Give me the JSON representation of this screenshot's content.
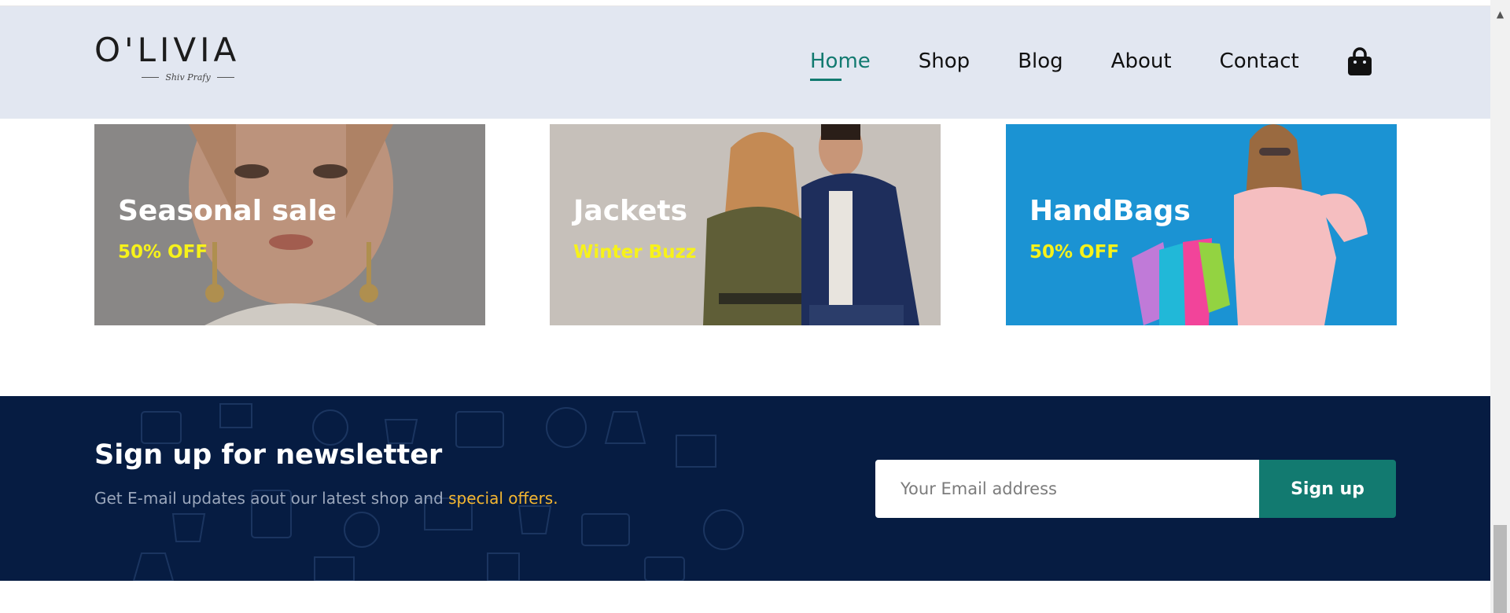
{
  "header": {
    "logo_text": "O'LIVIA",
    "logo_tagline": "Shiv Prafy",
    "nav": [
      {
        "label": "Home",
        "active": true
      },
      {
        "label": "Shop",
        "active": false
      },
      {
        "label": "Blog",
        "active": false
      },
      {
        "label": "About",
        "active": false
      },
      {
        "label": "Contact",
        "active": false
      }
    ],
    "cart_icon": "shopping-bag-icon"
  },
  "promos": [
    {
      "title": "Seasonal sale",
      "subtitle": "50% OFF"
    },
    {
      "title": "Jackets",
      "subtitle": "Winter Buzz"
    },
    {
      "title": "HandBags",
      "subtitle": "50% OFF"
    }
  ],
  "newsletter": {
    "title": "Sign up for newsletter",
    "desc_prefix": "Get E-mail updates aout our latest shop and ",
    "desc_highlight": "special offers.",
    "email_placeholder": "Your Email address",
    "button_label": "Sign up"
  },
  "colors": {
    "header_bg": "#e2e7f1",
    "accent": "#127a70",
    "newsletter_bg": "#061c42",
    "promo_subtitle": "#f7f21a",
    "highlight": "#f5b731"
  }
}
